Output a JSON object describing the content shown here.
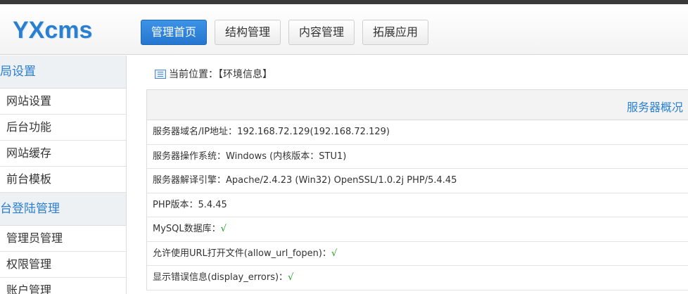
{
  "header": {
    "logo": "YXcms",
    "nav": [
      {
        "label": "管理首页",
        "active": true
      },
      {
        "label": "结构管理",
        "active": false
      },
      {
        "label": "内容管理",
        "active": false
      },
      {
        "label": "拓展应用",
        "active": false
      }
    ]
  },
  "sidebar": {
    "groups": [
      {
        "title": "局设置",
        "items": [
          "网站设置",
          "后台功能",
          "网站缓存",
          "前台模板"
        ]
      },
      {
        "title": "台登陆管理",
        "items": [
          "管理员管理",
          "权限管理",
          "账户管理"
        ]
      }
    ]
  },
  "breadcrumb": {
    "icon": "book-icon",
    "text": "当前位置：【环境信息】"
  },
  "panel": {
    "title": "服务器概况",
    "rows": [
      {
        "label": "服务器域名/IP地址：",
        "value": "192.168.72.129(192.168.72.129)"
      },
      {
        "label": "服务器操作系统：",
        "value": "Windows (内核版本：STU1)"
      },
      {
        "label": "服务器解译引擎：",
        "value": "Apache/2.4.23 (Win32) OpenSSL/1.0.2j PHP/5.4.45"
      },
      {
        "label": "PHP版本：",
        "value": "5.4.45"
      },
      {
        "label": "MySQL数据库：",
        "check": "√"
      },
      {
        "label": "允许使用URL打开文件(allow_url_fopen)：",
        "check": "√"
      },
      {
        "label": "显示错误信息(display_errors)：",
        "check": "√"
      }
    ]
  },
  "colors": {
    "accent": "#2a7fd0",
    "check": "#1a9a1a",
    "active_nav": "#2676cf"
  }
}
